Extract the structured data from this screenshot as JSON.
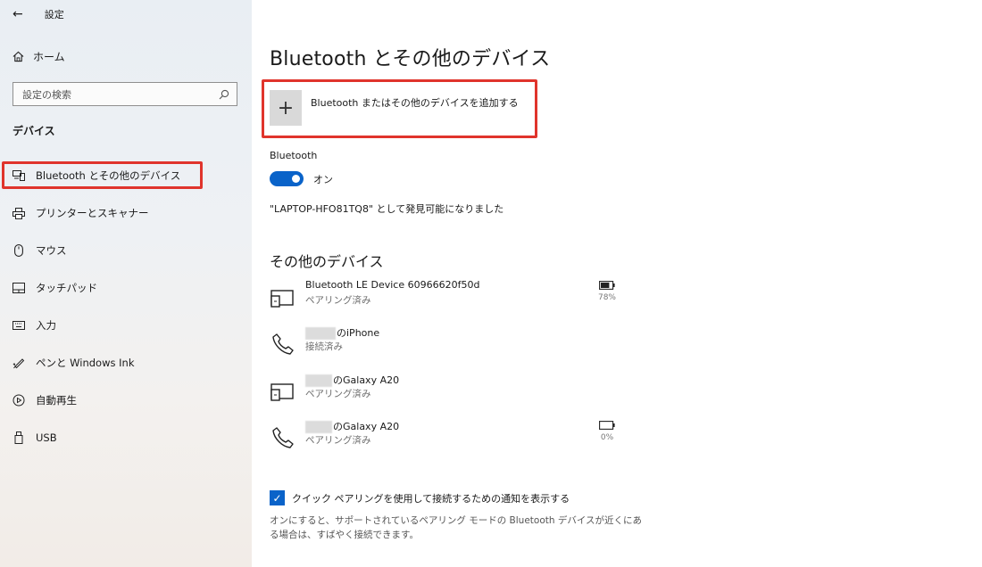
{
  "app": {
    "title": "設定"
  },
  "sidebar": {
    "home_label": "ホーム",
    "search_placeholder": "設定の検索",
    "section_label": "デバイス",
    "items": [
      {
        "label": "Bluetooth とその他のデバイス",
        "icon": "bluetooth-devices-icon",
        "selected": true
      },
      {
        "label": "プリンターとスキャナー",
        "icon": "printer-icon"
      },
      {
        "label": "マウス",
        "icon": "mouse-icon"
      },
      {
        "label": "タッチパッド",
        "icon": "touchpad-icon"
      },
      {
        "label": "入力",
        "icon": "keyboard-icon"
      },
      {
        "label": "ペンと Windows Ink",
        "icon": "pen-icon"
      },
      {
        "label": "自動再生",
        "icon": "autoplay-icon"
      },
      {
        "label": "USB",
        "icon": "usb-icon"
      }
    ]
  },
  "main": {
    "title": "Bluetooth とその他のデバイス",
    "add_device_label": "Bluetooth またはその他のデバイスを追加する",
    "bluetooth_label": "Bluetooth",
    "toggle_state": "オン",
    "discoverable_text": "\"LAPTOP-HFO81TQ8\" として発見可能になりました",
    "other_devices_title": "その他のデバイス",
    "devices": [
      {
        "name": "Bluetooth LE Device 60966620f50d",
        "status": "ペアリング済み",
        "icon": "device-icon",
        "battery": "78%",
        "battery_level": 0.78
      },
      {
        "name_suffix": "のiPhone",
        "status": "接続済み",
        "icon": "phone-icon"
      },
      {
        "name_suffix": "のGalaxy A20",
        "status": "ペアリング済み",
        "icon": "device-icon"
      },
      {
        "name_suffix": "のGalaxy A20",
        "status": "ペアリング済み",
        "icon": "phone-icon",
        "battery": "0%",
        "battery_level": 0
      }
    ],
    "quick_pair_label": "クイック ペアリングを使用して接続するための通知を表示する",
    "quick_pair_checked": true,
    "help_text": "オンにすると、サポートされているペアリング モードの Bluetooth デバイスが近くにある場合は、すばやく接続できます。"
  },
  "colors": {
    "accent": "#0a63c9",
    "highlight": "#e0342c"
  }
}
